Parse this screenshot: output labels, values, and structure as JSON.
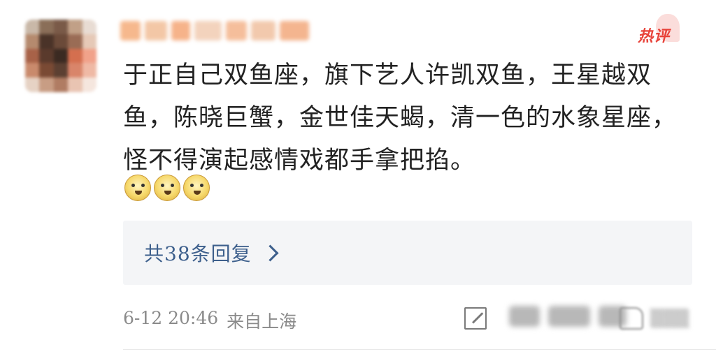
{
  "colors": {
    "accent_link": "#3d5f8c",
    "hot_badge": "#e8433a",
    "avatar_tiles": [
      "#c9b8a8",
      "#8a6e58",
      "#7a5a48",
      "#c1a087",
      "#e8dcd3",
      "#b58a6e",
      "#4a3328",
      "#6b4a39",
      "#9a6c55",
      "#e6c9b7",
      "#a86248",
      "#5a3a2c",
      "#3b2a22",
      "#d46f4f",
      "#f1a28a",
      "#c98a6c",
      "#7a4a34",
      "#5c4032",
      "#d9856a",
      "#efb9a5",
      "#e6d2c4",
      "#c89d84",
      "#b07c63",
      "#e9c4b2",
      "#f5e6de"
    ],
    "username_tiles": [
      "#f6b88d",
      "#f3c7a6",
      "#f6b38a",
      "#f3d3bd",
      "#f5be9b",
      "#f2c9ad",
      "#f4b58f"
    ]
  },
  "header": {
    "hot_badge": "热评"
  },
  "comment": {
    "text": "于正自己双鱼座，旗下艺人许凯双鱼，王星越双鱼，陈晓巨蟹，金世佳天蝎，清一色的水象星座，怪不得演起感情戏都手拿把掐。",
    "emojis": [
      "doge-emoji",
      "doge-emoji",
      "doge-emoji"
    ]
  },
  "replies": {
    "label": "共38条回复",
    "icon": "chevron-right-icon"
  },
  "meta": {
    "timestamp": "6-12 20:46",
    "source": "来自上海"
  },
  "actions": {
    "share_icon": "share-icon",
    "like_icon": "like-icon"
  }
}
